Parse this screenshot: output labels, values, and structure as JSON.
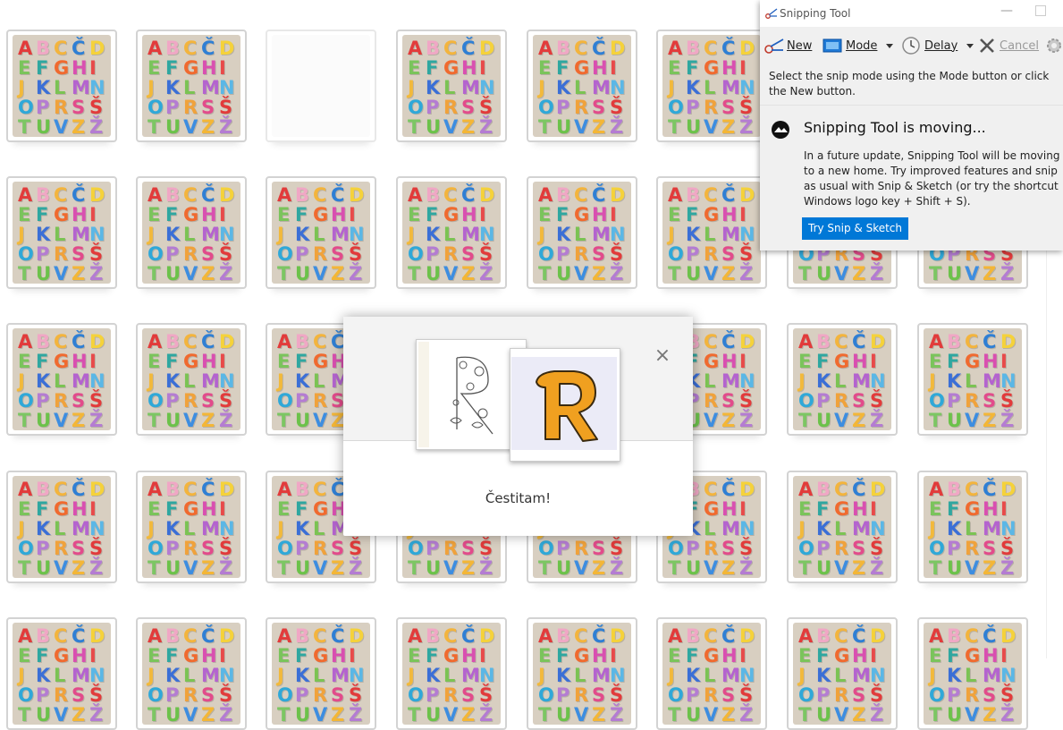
{
  "puzzle": {
    "letters": [
      "A",
      "B",
      "C",
      "Č",
      "D",
      "E",
      "F",
      "G",
      "H",
      "I",
      "J",
      "K",
      "L",
      "M",
      "N",
      "O",
      "P",
      "R",
      "S",
      "Š",
      "T",
      "U",
      "V",
      "Z",
      "Ž"
    ],
    "colors": [
      "#e23b3b",
      "#f0a7c5",
      "#f3b43d",
      "#2f7fd4",
      "#f5d23a",
      "#7ac45b",
      "#2fa7a0",
      "#f06a2f",
      "#d94fb0",
      "#e84a4a",
      "#f2b93b",
      "#3b6fd6",
      "#7bc353",
      "#b463cf",
      "#5ab7e6",
      "#2fa8d8",
      "#b47cd2",
      "#f0a23b",
      "#e24b8b",
      "#e23b3b",
      "#7cc663",
      "#6cc24a",
      "#3d8de0",
      "#f3b637",
      "#b47cd2"
    ]
  },
  "modal": {
    "close_glyph": "×",
    "message": "Čestitam!",
    "letter": "R",
    "letter_color": "#f0a020"
  },
  "snipping_tool": {
    "title": "Snipping Tool",
    "toolbar": {
      "new_label": "New",
      "mode_label": "Mode",
      "delay_label": "Delay",
      "cancel_label": "Cancel"
    },
    "hint": "Select the snip mode using the Mode button or click the New button.",
    "moving_title": "Snipping Tool is moving...",
    "moving_body": "In a future update, Snipping Tool will be moving to a new home. Try improved features and snip as usual with Snip & Sketch (or try the shortcut Windows logo key + Shift + S).",
    "try_button": "Try Snip & Sketch",
    "accent": "#0078d7"
  }
}
